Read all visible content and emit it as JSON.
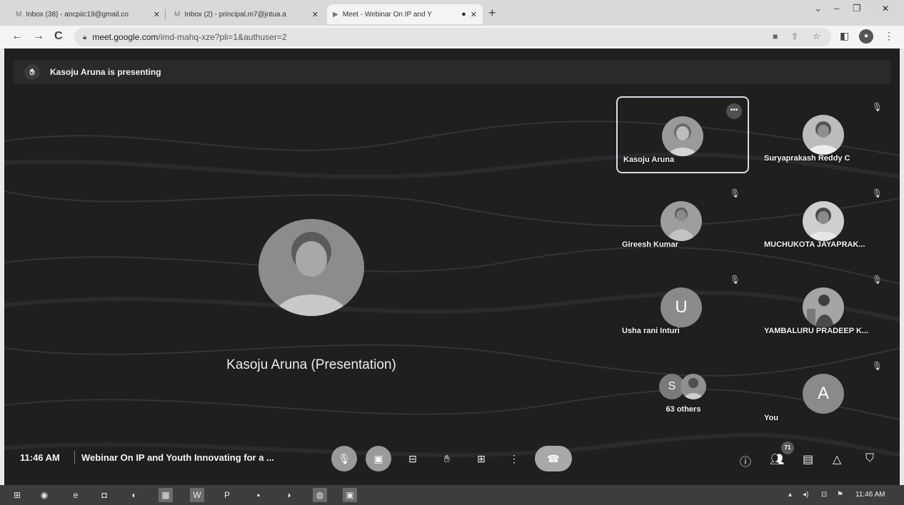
{
  "browser": {
    "tabs": [
      {
        "icon": "gmail-icon",
        "label": "Inbox (38) - ancpiic19@gmail.co",
        "close": "✕"
      },
      {
        "icon": "gmail-icon",
        "label": "Inbox (2) - principal.m7@jntua.a",
        "close": "✕"
      },
      {
        "icon": "meet-icon",
        "label": "Meet - Webinar On IP and Y",
        "close": "✕",
        "active": true
      }
    ],
    "new_tab": "+",
    "window_controls": {
      "menu": "⌄",
      "minimize": "–",
      "restore": "❐",
      "close": "✕"
    },
    "nav": {
      "back": "←",
      "forward": "→",
      "reload": "C"
    },
    "url": {
      "host": "meet.google.com",
      "path": "/imd-mahq-xze?pli=1&authuser=2"
    }
  },
  "meet": {
    "banner_text": "Kasoju Aruna is presenting",
    "main_name": "Kasoju Aruna (Presentation)",
    "participants": [
      {
        "name": "Kasoju Aruna",
        "type": "photo",
        "active": true,
        "more": "•••"
      },
      {
        "name": "Suryaprakash Reddy C",
        "type": "photo",
        "muted": true
      },
      {
        "name": "Gireesh Kumar",
        "type": "photo",
        "muted": true
      },
      {
        "name": "MUCHUKOTA JAYAPRAK...",
        "type": "photo",
        "muted": true
      },
      {
        "name": "Usha rani Inturi",
        "type": "initial",
        "initial": "U",
        "muted": true
      },
      {
        "name": "YAMBALURU PRADEEP K...",
        "type": "photo",
        "muted": true
      },
      {
        "name": "63 others",
        "type": "others",
        "initial": "S"
      },
      {
        "name": "You",
        "type": "initial",
        "initial": "A",
        "muted": true
      }
    ],
    "time": "11:46 AM",
    "meeting_title": "Webinar On IP and Youth Innovating for a ...",
    "people_count": "71"
  },
  "taskbar": {
    "time": "11:46 AM"
  }
}
